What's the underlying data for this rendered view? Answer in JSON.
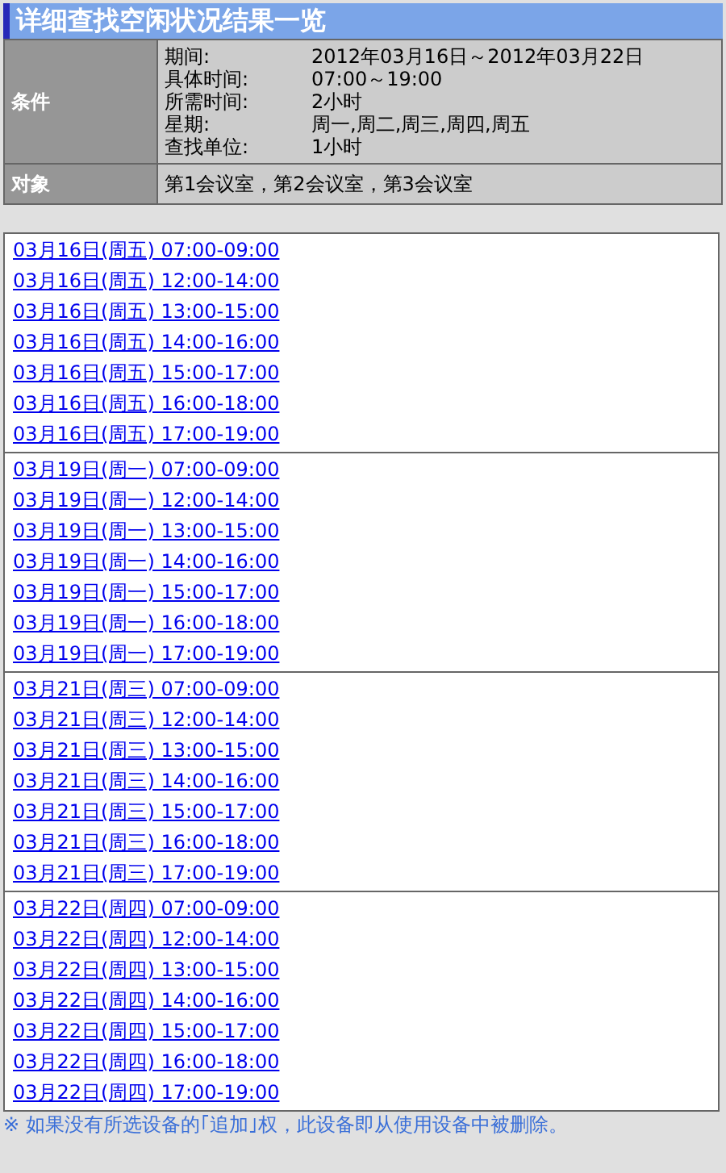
{
  "title": "详细查找空闲状况结果一览",
  "conditions": {
    "label": "条件",
    "items": [
      {
        "name": "期间:",
        "value": "2012年03月16日～2012年03月22日"
      },
      {
        "name": "具体时间:",
        "value": "07:00～19:00"
      },
      {
        "name": "所需时间:",
        "value": "2小时"
      },
      {
        "name": "星期:",
        "value": "周一,周二,周三,周四,周五"
      },
      {
        "name": "查找单位:",
        "value": "1小时"
      }
    ]
  },
  "target": {
    "label": "对象",
    "value": "第1会议室，第2会议室，第3会议室"
  },
  "groups": [
    {
      "slots": [
        "03月16日(周五) 07:00-09:00",
        "03月16日(周五) 12:00-14:00",
        "03月16日(周五) 13:00-15:00",
        "03月16日(周五) 14:00-16:00",
        "03月16日(周五) 15:00-17:00",
        "03月16日(周五) 16:00-18:00",
        "03月16日(周五) 17:00-19:00"
      ]
    },
    {
      "slots": [
        "03月19日(周一) 07:00-09:00",
        "03月19日(周一) 12:00-14:00",
        "03月19日(周一) 13:00-15:00",
        "03月19日(周一) 14:00-16:00",
        "03月19日(周一) 15:00-17:00",
        "03月19日(周一) 16:00-18:00",
        "03月19日(周一) 17:00-19:00"
      ]
    },
    {
      "slots": [
        "03月21日(周三) 07:00-09:00",
        "03月21日(周三) 12:00-14:00",
        "03月21日(周三) 13:00-15:00",
        "03月21日(周三) 14:00-16:00",
        "03月21日(周三) 15:00-17:00",
        "03月21日(周三) 16:00-18:00",
        "03月21日(周三) 17:00-19:00"
      ]
    },
    {
      "slots": [
        "03月22日(周四) 07:00-09:00",
        "03月22日(周四) 12:00-14:00",
        "03月22日(周四) 13:00-15:00",
        "03月22日(周四) 14:00-16:00",
        "03月22日(周四) 15:00-17:00",
        "03月22日(周四) 16:00-18:00",
        "03月22日(周四) 17:00-19:00"
      ]
    }
  ],
  "note": "※ 如果没有所选设备的｢追加｣权，此设备即从使用设备中被删除。"
}
